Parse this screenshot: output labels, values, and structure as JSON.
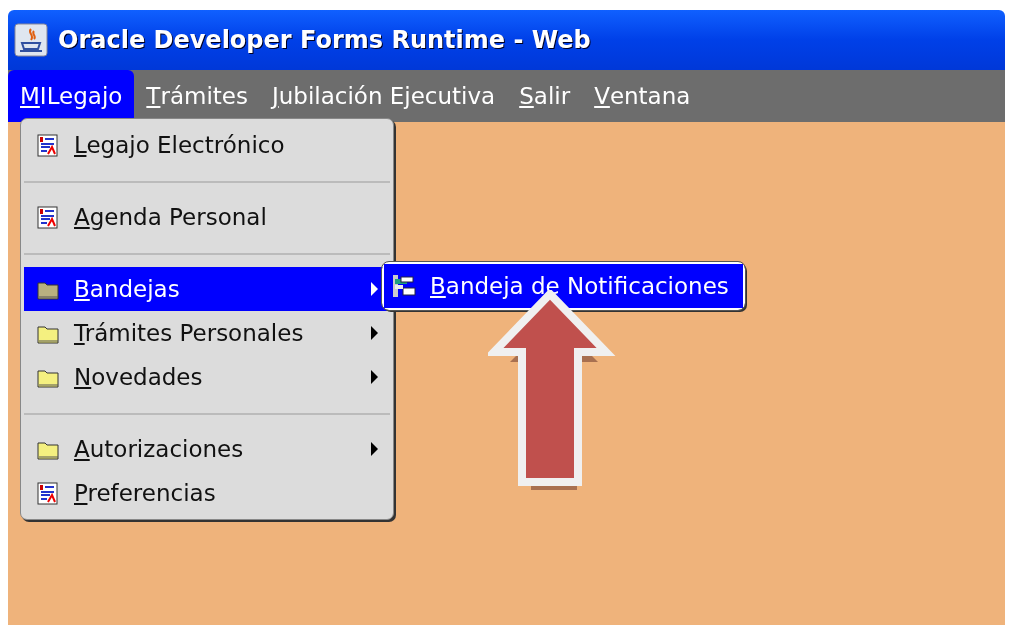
{
  "window": {
    "title": "Oracle Developer Forms Runtime - Web"
  },
  "menu_bar": [
    {
      "label": "MILegajo",
      "selected": true
    },
    {
      "label": "Trámites",
      "selected": false
    },
    {
      "label": "Jubilación Ejecutiva",
      "selected": false
    },
    {
      "label": "Salir",
      "selected": false
    },
    {
      "label": "Ventana",
      "selected": false
    }
  ],
  "dropdown": {
    "groups": [
      [
        {
          "label": "Legajo Electrónico",
          "kind": "document",
          "submenu": false,
          "selected": false
        }
      ],
      [
        {
          "label": "Agenda Personal",
          "kind": "document",
          "submenu": false,
          "selected": false
        }
      ],
      [
        {
          "label": "Bandejas",
          "kind": "folder",
          "submenu": true,
          "selected": true
        },
        {
          "label": "Trámites Personales",
          "kind": "folder",
          "submenu": true,
          "selected": false
        },
        {
          "label": "Novedades",
          "kind": "folder",
          "submenu": true,
          "selected": false
        }
      ],
      [
        {
          "label": "Autorizaciones",
          "kind": "folder",
          "submenu": true,
          "selected": false
        },
        {
          "label": "Preferencias",
          "kind": "document",
          "submenu": false,
          "selected": false
        }
      ]
    ]
  },
  "submenu": {
    "items": [
      {
        "label": "Bandeja de Notificaciones",
        "kind": "tree",
        "selected": true
      }
    ]
  }
}
